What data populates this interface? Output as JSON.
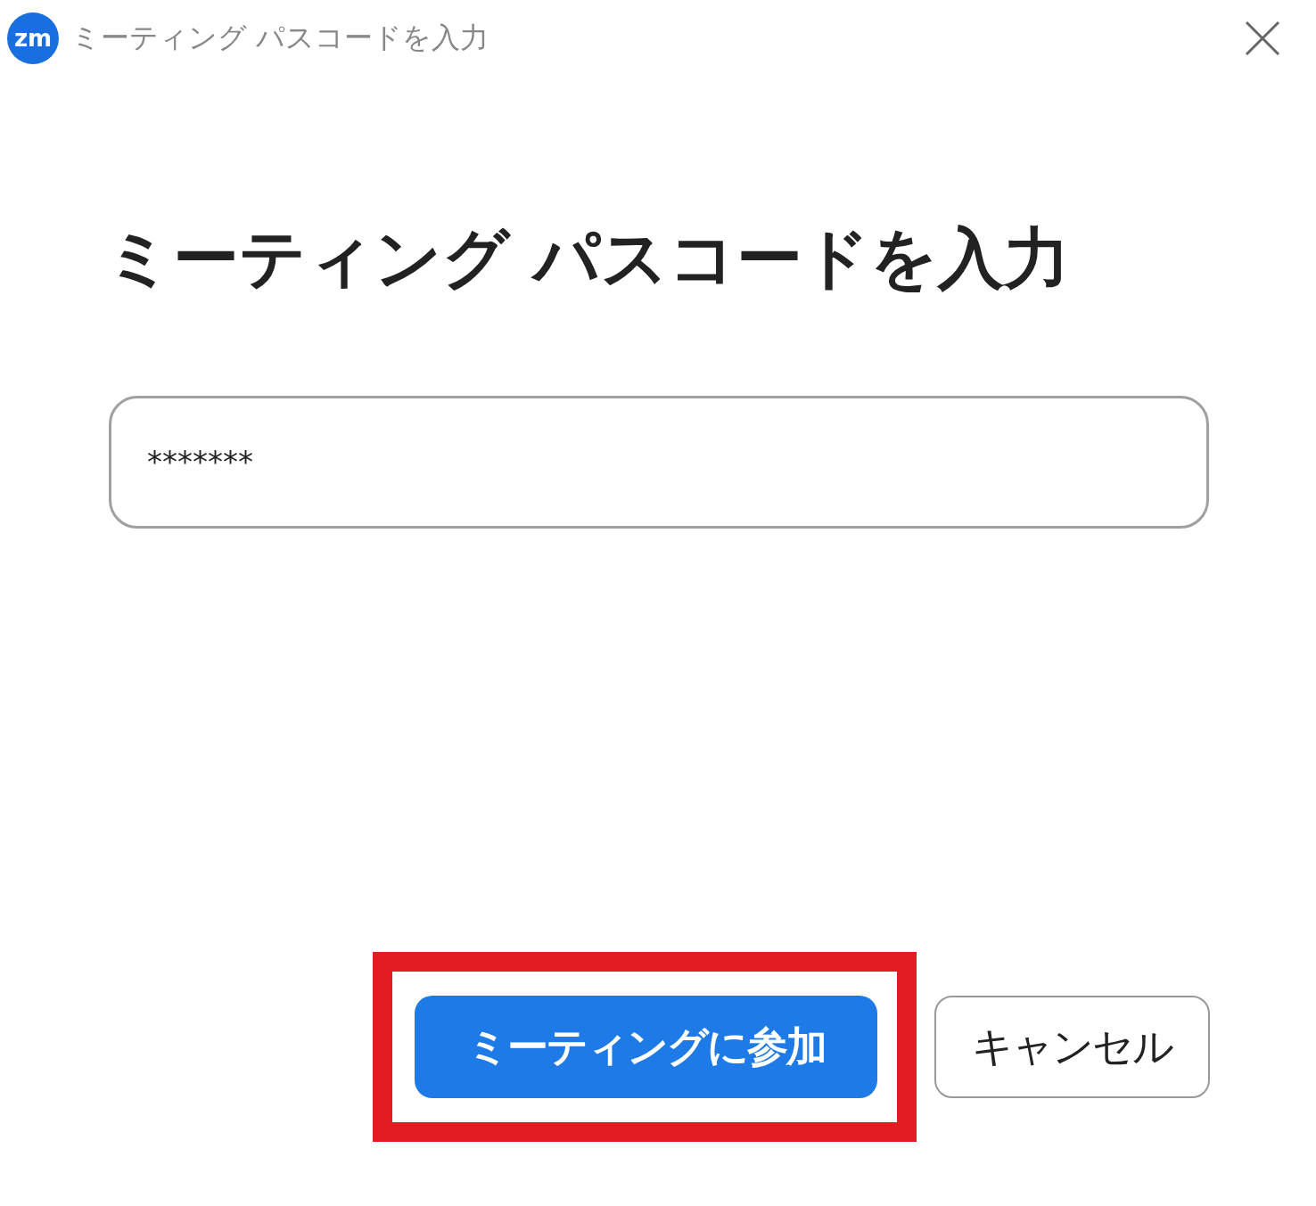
{
  "window": {
    "logo": "zm",
    "title": "ミーティング パスコードを入力"
  },
  "heading": "ミーティング パスコードを入力",
  "passcode_field": {
    "value": "*******"
  },
  "buttons": [
    {
      "kind": "primary",
      "label": "ミーティングに参加",
      "highlighted": true
    },
    {
      "kind": "secondary",
      "label": "キャンセル",
      "highlighted": false
    }
  ]
}
